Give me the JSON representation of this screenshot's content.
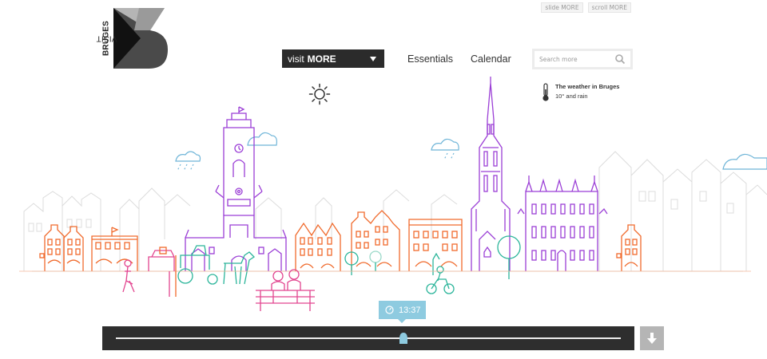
{
  "brand": {
    "visit": "VISIT",
    "bruges": "BRUGES"
  },
  "top_links": [
    "slide MORE",
    "scroll MORE"
  ],
  "header": {
    "visit_more": {
      "prefix": "visit",
      "bold": "MORE"
    },
    "nav": [
      "Essentials",
      "Calendar"
    ],
    "search": {
      "placeholder": "Search more",
      "value": ""
    }
  },
  "weather": {
    "title": "The weather in Bruges",
    "detail": "10° and rain"
  },
  "timeline": {
    "time": "13:37",
    "progress_fraction": 0.57
  },
  "colors": {
    "orange": "#f06a2c",
    "purple": "#9b3fd6",
    "pink": "#e2448f",
    "teal": "#2bb59a",
    "sky": "#8ecbe0",
    "dark": "#2b2b2b",
    "grey_outline": "#d9d9d9"
  },
  "icons": [
    "sun-icon",
    "thermometer-icon",
    "search-icon",
    "clock-icon",
    "down-arrow-icon",
    "caret-down-icon"
  ]
}
